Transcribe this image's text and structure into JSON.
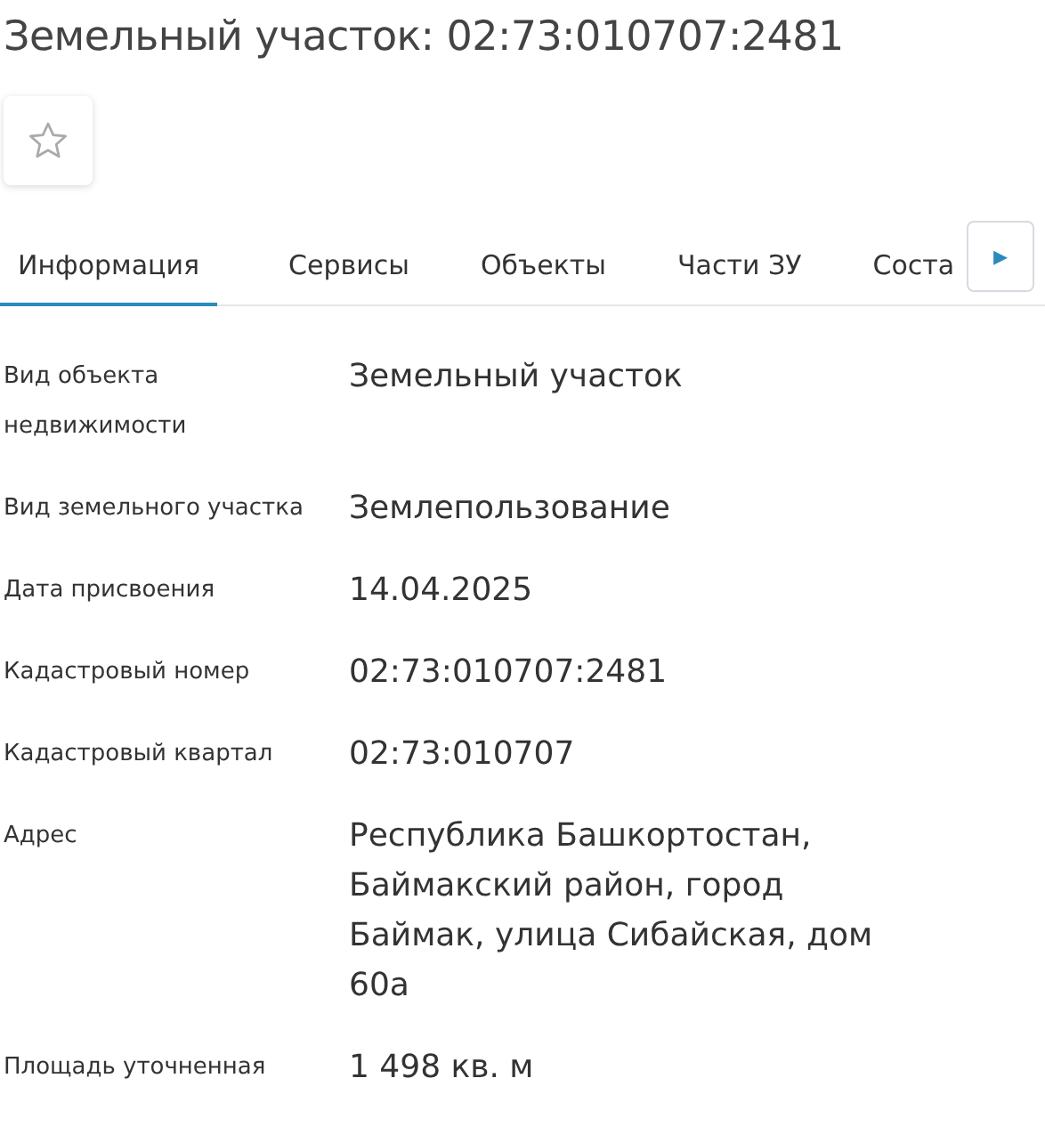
{
  "title": "Земельный участок: 02:73:010707:2481",
  "favorite": {
    "on": false
  },
  "tabs": [
    {
      "label": "Информация",
      "selected": true
    },
    {
      "label": "Сервисы",
      "selected": false
    },
    {
      "label": "Объекты",
      "selected": false
    },
    {
      "label": "Части ЗУ",
      "selected": false
    },
    {
      "label": "Соста",
      "selected": false
    }
  ],
  "tab_scroll": {
    "label": "▸"
  },
  "fields": [
    {
      "label": "Вид объекта недвижимости",
      "value": "Земельный участок"
    },
    {
      "label": "Вид земельного участка",
      "value": "Землепользование"
    },
    {
      "label": "Дата присвоения",
      "value": "14.04.2025"
    },
    {
      "label": "Кадастровый номер",
      "value": "02:73:010707:2481"
    },
    {
      "label": "Кадастровый квартал",
      "value": "02:73:010707"
    },
    {
      "label": "Адрес",
      "value": "Республика Башкортостан, Баймакский район, город Баймак, улица Сибайская, дом 60а"
    },
    {
      "label": "Площадь уточненная",
      "value": "1 498 кв. м"
    }
  ]
}
